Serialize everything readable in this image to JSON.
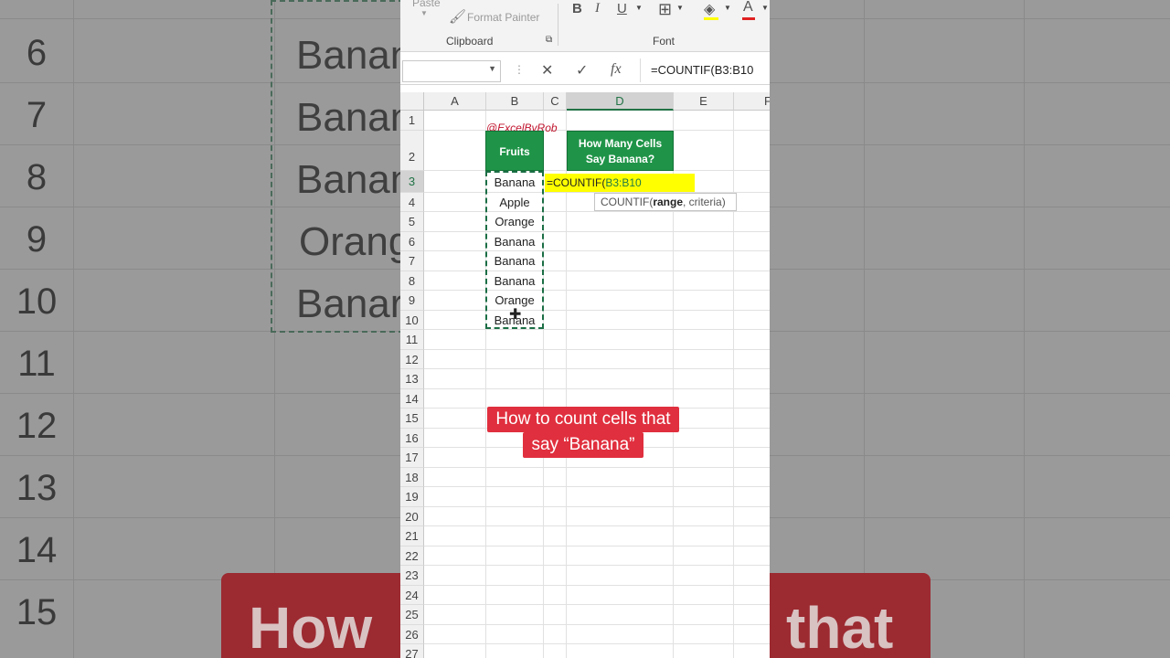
{
  "ribbon": {
    "paste_label": "Paste",
    "format_painter_label": "Format Painter",
    "clipboard_group": "Clipboard",
    "font_group": "Font",
    "bold_label": "B",
    "italic_label": "I",
    "underline_label": "U",
    "font_color_label": "A"
  },
  "formula_bar": {
    "name_box": "",
    "formula": "=COUNTIF(B3:B10",
    "fx_label": "fx"
  },
  "sheet": {
    "columns": [
      "A",
      "B",
      "C",
      "D",
      "E",
      "F"
    ],
    "rows": [
      "1",
      "2",
      "3",
      "4",
      "5",
      "6",
      "7",
      "8",
      "9",
      "10",
      "11",
      "12",
      "13",
      "14",
      "15",
      "16",
      "17",
      "18",
      "19",
      "20",
      "21",
      "22",
      "23",
      "24",
      "25",
      "26",
      "27"
    ],
    "handle": "@ExcelByRob",
    "fruits_header": "Fruits",
    "count_header_line1": "How Many Cells",
    "count_header_line2": "Say Banana?",
    "fruits": [
      "Banana",
      "Apple",
      "Orange",
      "Banana",
      "Banana",
      "Banana",
      "Orange",
      "Banana"
    ],
    "edit_formula_prefix": "=COUNTIF(",
    "edit_formula_ref": "B3:B10",
    "tooltip_fn": "COUNTIF(",
    "tooltip_arg1": "range",
    "tooltip_rest": ", criteria)"
  },
  "caption": {
    "line1": "How to count cells that",
    "line2": "say “Banana”"
  },
  "background": {
    "row_numbers": [
      "6",
      "7",
      "8",
      "9",
      "10",
      "11",
      "12",
      "13",
      "14",
      "15"
    ],
    "words": [
      "Banan",
      "Banan",
      "Banan",
      "Orang",
      "Banar"
    ],
    "caption_left": "How",
    "caption_right": "that"
  },
  "colors": {
    "header_green": "#1f9448",
    "caption_red": "#e02f3e",
    "handle_red": "#c0142d",
    "highlight_yellow": "#ffff00"
  }
}
